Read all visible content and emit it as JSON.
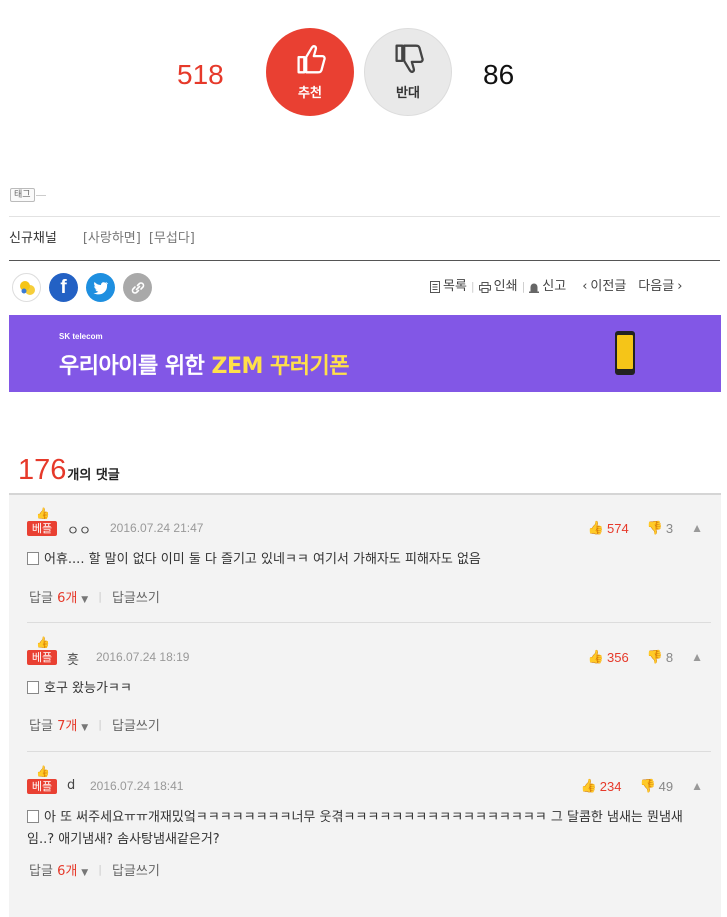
{
  "vote": {
    "up_count": "518",
    "up_label": "추천",
    "down_count": "86",
    "down_label": "반대"
  },
  "tag": {
    "label": "태그"
  },
  "channel": {
    "name": "신규채널",
    "tags": [
      "[사랑하면]",
      "[무섭다]"
    ]
  },
  "toolbar": {
    "list": "목록",
    "print": "인쇄",
    "report": "신고",
    "prev": "이전글",
    "next": "다음글"
  },
  "banner": {
    "brand": "SK telecom",
    "text_a": "우리아이를 위한 ",
    "text_b": "ZEM 꾸러기폰"
  },
  "comments_header": {
    "count": "176",
    "label": "개의 댓글"
  },
  "comments": [
    {
      "badge": "베플",
      "author": "ㅇㅇ",
      "date": "2016.07.24 21:47",
      "up": "574",
      "down": "3",
      "text": "어휴.... 할 말이 없다 이미 둘 다 즐기고 있네ㅋㅋ 여기서 가해자도 피해자도 없음",
      "reply_label": "답글",
      "reply_count": "6개",
      "write_reply": "답글쓰기"
    },
    {
      "badge": "베플",
      "author": "흣",
      "date": "2016.07.24 18:19",
      "up": "356",
      "down": "8",
      "text": "호구 왔능가ㅋㅋ",
      "reply_label": "답글",
      "reply_count": "7개",
      "write_reply": "답글쓰기"
    },
    {
      "badge": "베플",
      "author": "d",
      "date": "2016.07.24 18:41",
      "up": "234",
      "down": "49",
      "text": "아 또 써주세요ㅠㅠ개재밌엌ㅋㅋㅋㅋㅋㅋㅋㅋ너무 웃겪ㅋㅋㅋㅋㅋㅋㅋㅋㅋㅋㅋㅋㅋㅋㅋㅋㅋ 그 달콤한 냄새는 뭔냄새임..? 애기냄새? 솜사탕냄새같은거?",
      "reply_label": "답글",
      "reply_count": "6개",
      "write_reply": "답글쓰기"
    }
  ],
  "colors": {
    "accent_red": "#e94032",
    "banner_purple": "#8257e6",
    "facebook": "#2361c4",
    "twitter": "#1e8fe0"
  }
}
